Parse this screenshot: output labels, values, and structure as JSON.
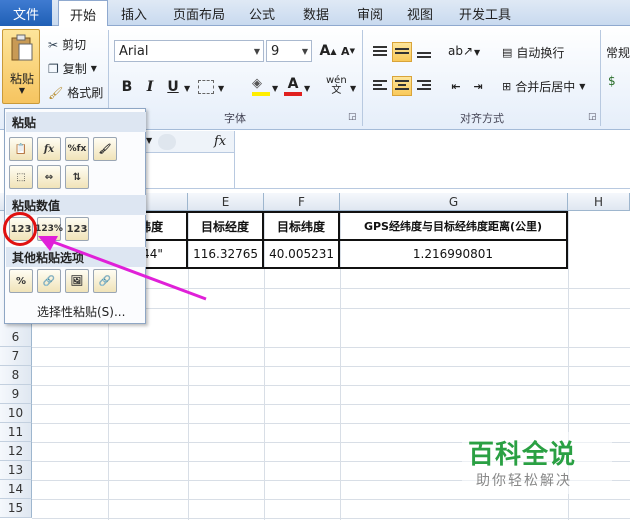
{
  "tabs": {
    "file": "文件",
    "items": [
      "开始",
      "插入",
      "页面布局",
      "公式",
      "数据",
      "审阅",
      "视图",
      "开发工具"
    ]
  },
  "ribbon": {
    "clipboard": {
      "paste_label": "粘贴",
      "cut_label": "剪切",
      "copy_label": "复制",
      "format_painter_label": "格式刷"
    },
    "font": {
      "font_name": "Arial",
      "font_size": "9",
      "group_label": "字体"
    },
    "alignment": {
      "wrap_text_label": "自动换行",
      "merge_center_label": "合并后居中",
      "group_label": "对齐方式"
    },
    "number": {
      "format_label": "常规"
    }
  },
  "paste_menu": {
    "header_paste": "粘贴",
    "header_values": "粘贴数值",
    "header_other": "其他粘贴选项",
    "paste_special_label": "选择性粘贴(S)..."
  },
  "sheet": {
    "name_box": "",
    "formula_fx": "fx",
    "columns": [
      "D",
      "E",
      "F",
      "G",
      "H"
    ],
    "row_numbers": [
      "6",
      "7",
      "8",
      "9",
      "10",
      "11",
      "12",
      "13",
      "14",
      "15"
    ],
    "headers": {
      "d": "1纬度",
      "e": "目标经度",
      "f": "目标纬度",
      "g": "GPS经纬度与目标经纬度距离(公里)"
    },
    "row_values": {
      "d": "0'44\"",
      "e": "116.32765",
      "f": "40.005231",
      "g": "1.216990801"
    }
  },
  "watermark": {
    "title": "百科全说",
    "subtitle": "助你轻松解决"
  },
  "colors": {
    "file_tab": "#2a66c0",
    "highlight_circle": "#e01010",
    "arrow": "#e020d8",
    "watermark_green": "#2aa043"
  }
}
